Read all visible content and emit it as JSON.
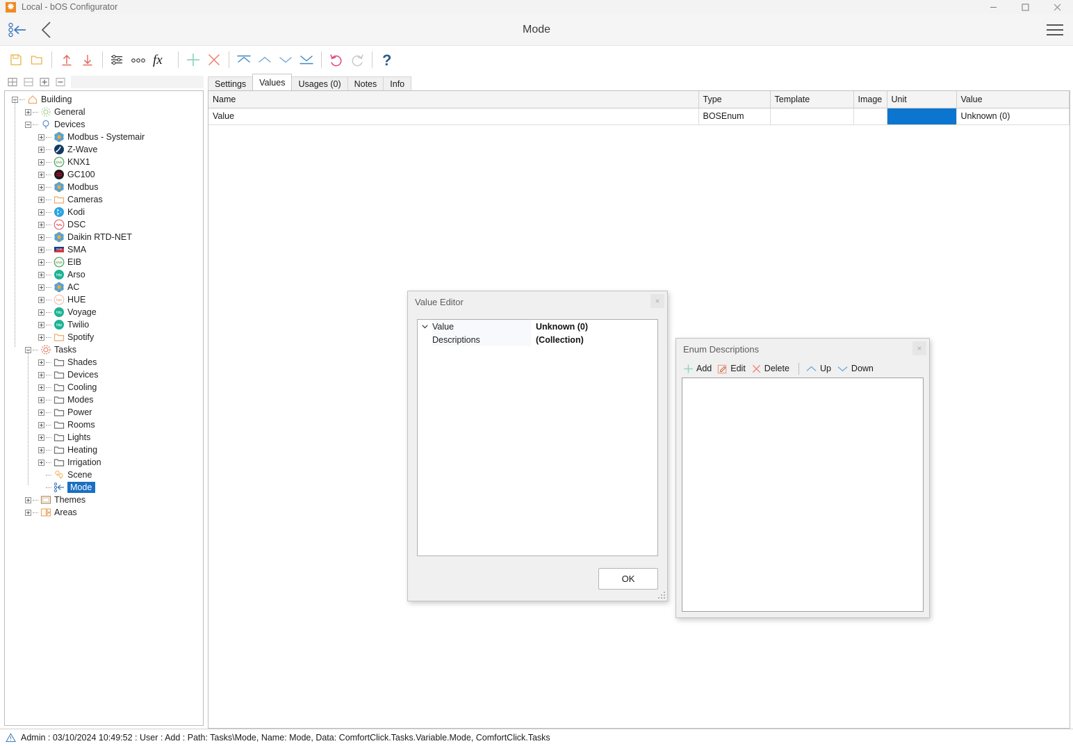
{
  "window": {
    "title": "Local - bOS Configurator",
    "app_icon": "gear-icon",
    "minimize_label": "Minimize",
    "maximize_label": "Maximize",
    "close_label": "Close"
  },
  "navbar": {
    "title": "Mode",
    "back_icon": "variable-back-arrow-icon",
    "prev_icon": "chevron-left-icon",
    "menu_icon": "hamburger-menu-icon"
  },
  "toolbar": {
    "buttons": [
      {
        "name": "save-button",
        "icon": "floppy-disk-icon",
        "label": "Save"
      },
      {
        "name": "open-button",
        "icon": "folder-icon",
        "label": "Open"
      },
      {
        "name": "upload-button",
        "icon": "upload-arrow-icon",
        "label": "Upload"
      },
      {
        "name": "download-button",
        "icon": "download-arrow-icon",
        "label": "Download"
      },
      {
        "name": "properties-button",
        "icon": "sliders-icon",
        "label": "Properties"
      },
      {
        "name": "more-button",
        "icon": "ellipsis-icon",
        "label": "More"
      },
      {
        "name": "function-button",
        "icon": "fx-icon",
        "label": "fx"
      },
      {
        "name": "add-button",
        "icon": "plus-icon",
        "label": "Add"
      },
      {
        "name": "delete-button",
        "icon": "cross-icon",
        "label": "Delete"
      },
      {
        "name": "move-top-button",
        "icon": "move-to-top-icon",
        "label": "Move to top"
      },
      {
        "name": "move-up-button",
        "icon": "chevron-up-icon",
        "label": "Move up"
      },
      {
        "name": "move-down-button",
        "icon": "chevron-down-icon",
        "label": "Move down"
      },
      {
        "name": "move-bottom-button",
        "icon": "move-to-bottom-icon",
        "label": "Move to bottom"
      },
      {
        "name": "undo-button",
        "icon": "undo-icon",
        "label": "Undo"
      },
      {
        "name": "redo-button",
        "icon": "redo-icon",
        "label": "Redo"
      },
      {
        "name": "help-button",
        "icon": "question-mark-icon",
        "label": "Help"
      }
    ]
  },
  "tree_toolbar": {
    "buttons": [
      {
        "name": "expand-all-button",
        "icon": "expand-all-icon",
        "label": "Expand all"
      },
      {
        "name": "collapse-all-button",
        "icon": "collapse-all-icon",
        "label": "Collapse all"
      },
      {
        "name": "expand-node-button",
        "icon": "expand-node-icon",
        "label": "Expand"
      },
      {
        "name": "collapse-node-button",
        "icon": "collapse-node-icon",
        "label": "Collapse"
      }
    ]
  },
  "tree": {
    "nodes": [
      {
        "label": "Building",
        "depth": 0,
        "expander": "minus",
        "icon": "house-icon",
        "selected": false
      },
      {
        "label": "General",
        "depth": 1,
        "expander": "plus",
        "icon": "gear-outline-icon",
        "selected": false
      },
      {
        "label": "Devices",
        "depth": 1,
        "expander": "minus",
        "icon": "bulb-icon",
        "selected": false
      },
      {
        "label": "Modbus - Systemair",
        "depth": 2,
        "expander": "plus",
        "icon": "flower-icon",
        "selected": false
      },
      {
        "label": "Z-Wave",
        "depth": 2,
        "expander": "plus",
        "icon": "zwave-icon",
        "selected": false
      },
      {
        "label": "KNX1",
        "depth": 2,
        "expander": "plus",
        "icon": "knx-icon",
        "selected": false
      },
      {
        "label": "GC100",
        "depth": 2,
        "expander": "plus",
        "icon": "gc100-icon",
        "selected": false
      },
      {
        "label": "Modbus",
        "depth": 2,
        "expander": "plus",
        "icon": "flower-icon",
        "selected": false
      },
      {
        "label": "Cameras",
        "depth": 2,
        "expander": "plus",
        "icon": "folder-orange-icon",
        "selected": false
      },
      {
        "label": "Kodi",
        "depth": 2,
        "expander": "plus",
        "icon": "kodi-icon",
        "selected": false
      },
      {
        "label": "DSC",
        "depth": 2,
        "expander": "plus",
        "icon": "dsc-icon",
        "selected": false
      },
      {
        "label": "Daikin RTD-NET",
        "depth": 2,
        "expander": "plus",
        "icon": "flower-icon",
        "selected": false
      },
      {
        "label": "SMA",
        "depth": 2,
        "expander": "plus",
        "icon": "sma-icon",
        "selected": false
      },
      {
        "label": "EIB",
        "depth": 2,
        "expander": "plus",
        "icon": "knx-icon",
        "selected": false
      },
      {
        "label": "Arso",
        "depth": 2,
        "expander": "plus",
        "icon": "http-icon",
        "selected": false
      },
      {
        "label": "AC",
        "depth": 2,
        "expander": "plus",
        "icon": "flower-icon",
        "selected": false
      },
      {
        "label": "HUE",
        "depth": 2,
        "expander": "plus",
        "icon": "hue-icon",
        "selected": false
      },
      {
        "label": "Voyage",
        "depth": 2,
        "expander": "plus",
        "icon": "http-icon",
        "selected": false
      },
      {
        "label": "Twilio",
        "depth": 2,
        "expander": "plus",
        "icon": "http-icon",
        "selected": false
      },
      {
        "label": "Spotify",
        "depth": 2,
        "expander": "plus",
        "icon": "folder-orange-icon",
        "selected": false
      },
      {
        "label": "Tasks",
        "depth": 1,
        "expander": "minus",
        "icon": "tasks-gear-icon",
        "selected": false
      },
      {
        "label": "Shades",
        "depth": 2,
        "expander": "plus",
        "icon": "folder-gray-icon",
        "selected": false
      },
      {
        "label": "Devices",
        "depth": 2,
        "expander": "plus",
        "icon": "folder-gray-icon",
        "selected": false
      },
      {
        "label": "Cooling",
        "depth": 2,
        "expander": "plus",
        "icon": "folder-gray-icon",
        "selected": false
      },
      {
        "label": "Modes",
        "depth": 2,
        "expander": "plus",
        "icon": "folder-gray-icon",
        "selected": false
      },
      {
        "label": "Power",
        "depth": 2,
        "expander": "plus",
        "icon": "folder-gray-icon",
        "selected": false
      },
      {
        "label": "Rooms",
        "depth": 2,
        "expander": "plus",
        "icon": "folder-gray-icon",
        "selected": false
      },
      {
        "label": "Lights",
        "depth": 2,
        "expander": "plus",
        "icon": "folder-gray-icon",
        "selected": false
      },
      {
        "label": "Heating",
        "depth": 2,
        "expander": "plus",
        "icon": "folder-gray-icon",
        "selected": false
      },
      {
        "label": "Irrigation",
        "depth": 2,
        "expander": "plus",
        "icon": "folder-gray-icon",
        "selected": false
      },
      {
        "label": "Scene",
        "depth": 2,
        "expander": "none",
        "icon": "scene-bulbs-icon",
        "selected": false
      },
      {
        "label": "Mode",
        "depth": 2,
        "expander": "none",
        "icon": "variable-back-arrow-icon",
        "selected": true
      },
      {
        "label": "Themes",
        "depth": 1,
        "expander": "plus",
        "icon": "themes-icon",
        "selected": false
      },
      {
        "label": "Areas",
        "depth": 1,
        "expander": "plus",
        "icon": "areas-icon",
        "selected": false
      }
    ]
  },
  "tabs": [
    {
      "label": "Settings",
      "active": false,
      "name": "tab-settings"
    },
    {
      "label": "Values",
      "active": true,
      "name": "tab-values"
    },
    {
      "label": "Usages (0)",
      "active": false,
      "name": "tab-usages"
    },
    {
      "label": "Notes",
      "active": false,
      "name": "tab-notes"
    },
    {
      "label": "Info",
      "active": false,
      "name": "tab-info"
    }
  ],
  "values_grid": {
    "columns": [
      "Name",
      "Type",
      "Template",
      "Image",
      "Unit",
      "Value"
    ],
    "rows": [
      {
        "Name": "Value",
        "Type": "BOSEnum",
        "Template": "",
        "Image": "",
        "Unit": "",
        "Value": "Unknown (0)"
      }
    ],
    "selected_cell": {
      "row": 0,
      "column": "Unit"
    },
    "selection_color": "#0c75d0"
  },
  "value_editor": {
    "title": "Value Editor",
    "close_label": "×",
    "properties": [
      {
        "name": "Value",
        "value": "Unknown (0)",
        "expanded": true,
        "child": false
      },
      {
        "name": "Descriptions",
        "value": "(Collection)",
        "expanded": false,
        "child": true
      }
    ],
    "ok_label": "OK"
  },
  "enum_descriptions": {
    "title": "Enum Descriptions",
    "close_label": "×",
    "toolbar": [
      {
        "label": "Add",
        "icon": "plus-icon",
        "name": "enum-add-button"
      },
      {
        "label": "Edit",
        "icon": "pencil-box-icon",
        "name": "enum-edit-button"
      },
      {
        "label": "Delete",
        "icon": "cross-icon",
        "name": "enum-delete-button"
      },
      {
        "label": "Up",
        "icon": "chevron-up-icon",
        "name": "enum-up-button"
      },
      {
        "label": "Down",
        "icon": "chevron-down-icon",
        "name": "enum-down-button"
      }
    ],
    "items": []
  },
  "statusbar": {
    "icon": "warning-triangle-icon",
    "text": "Admin : 03/10/2024 10:49:52 : User : Add : Path: Tasks\\Mode, Name: Mode, Data: ComfortClick.Tasks.Variable.Mode, ComfortClick.Tasks"
  }
}
